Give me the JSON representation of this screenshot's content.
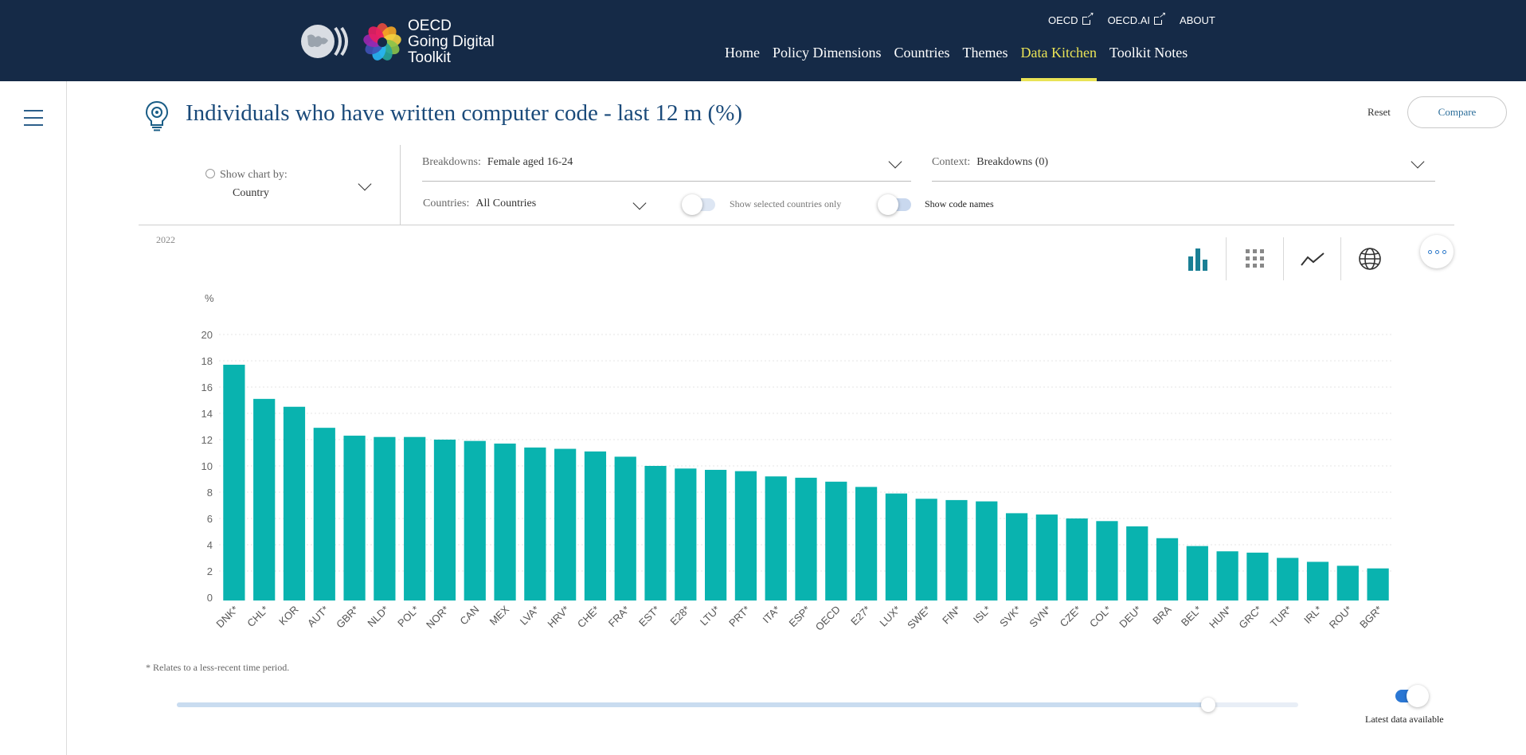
{
  "header": {
    "logo_text": [
      "OECD",
      "Going Digital",
      "Toolkit"
    ],
    "top_links": [
      {
        "label": "OECD",
        "external": true
      },
      {
        "label": "OECD.AI",
        "external": true
      },
      {
        "label": "ABOUT",
        "external": false
      }
    ],
    "nav": [
      {
        "label": "Home",
        "active": false
      },
      {
        "label": "Policy Dimensions",
        "active": false
      },
      {
        "label": "Countries",
        "active": false
      },
      {
        "label": "Themes",
        "active": false
      },
      {
        "label": "Data Kitchen",
        "active": true
      },
      {
        "label": "Toolkit Notes",
        "active": false
      }
    ],
    "colors": {
      "background": "#152a47",
      "active": "#e9e356"
    }
  },
  "title": "Individuals who have written computer code - last 12 m (%)",
  "actions": {
    "reset": "Reset",
    "compare": "Compare"
  },
  "controls": {
    "show_chart_by_label": "Show chart by:",
    "show_chart_by_value": "Country",
    "breakdowns_label": "Breakdowns:",
    "breakdowns_value": "Female aged 16-24",
    "context_label": "Context:",
    "context_value": "Breakdowns (0)",
    "countries_label": "Countries:",
    "countries_value": "All Countries",
    "show_selected_label": "Show selected countries only",
    "show_selected_on": false,
    "show_code_names_label": "Show code names",
    "show_code_names_on": true
  },
  "chart_year": "2022",
  "chart_views": [
    "bar-chart-icon",
    "grid-icon",
    "line-chart-icon",
    "globe-icon"
  ],
  "chart_data": {
    "type": "bar",
    "ylabel": "%",
    "ylim": [
      0,
      20
    ],
    "yticks": [
      0,
      2,
      4,
      6,
      8,
      10,
      12,
      14,
      16,
      18,
      20
    ],
    "grid": true,
    "color": "#09b3af",
    "categories": [
      "DNK*",
      "CHL*",
      "KOR",
      "AUT*",
      "GBR*",
      "NLD*",
      "POL*",
      "NOR*",
      "CAN",
      "MEX",
      "LVA*",
      "HRV*",
      "CHE*",
      "FRA*",
      "EST*",
      "E28*",
      "LTU*",
      "PRT*",
      "ITA*",
      "ESP*",
      "OECD",
      "E27*",
      "LUX*",
      "SWE*",
      "FIN*",
      "ISL*",
      "SVK*",
      "SVN*",
      "CZE*",
      "COL*",
      "DEU*",
      "BRA",
      "BEL*",
      "HUN*",
      "GRC*",
      "TUR*",
      "IRL*",
      "ROU*",
      "BGR*"
    ],
    "values": [
      17.7,
      15.1,
      14.5,
      12.9,
      12.3,
      12.2,
      12.2,
      12.0,
      11.9,
      11.7,
      11.4,
      11.3,
      11.1,
      10.7,
      10.0,
      9.8,
      9.7,
      9.6,
      9.2,
      9.1,
      8.8,
      8.4,
      7.9,
      7.5,
      7.4,
      7.3,
      6.4,
      6.3,
      6.0,
      5.8,
      5.4,
      4.5,
      3.9,
      3.5,
      3.4,
      3.0,
      2.7,
      2.4,
      2.2
    ]
  },
  "footnote": "* Relates to a less-recent time period.",
  "time_slider": {
    "position": 0.92
  },
  "latest_data": {
    "label": "Latest data available",
    "on": true
  }
}
